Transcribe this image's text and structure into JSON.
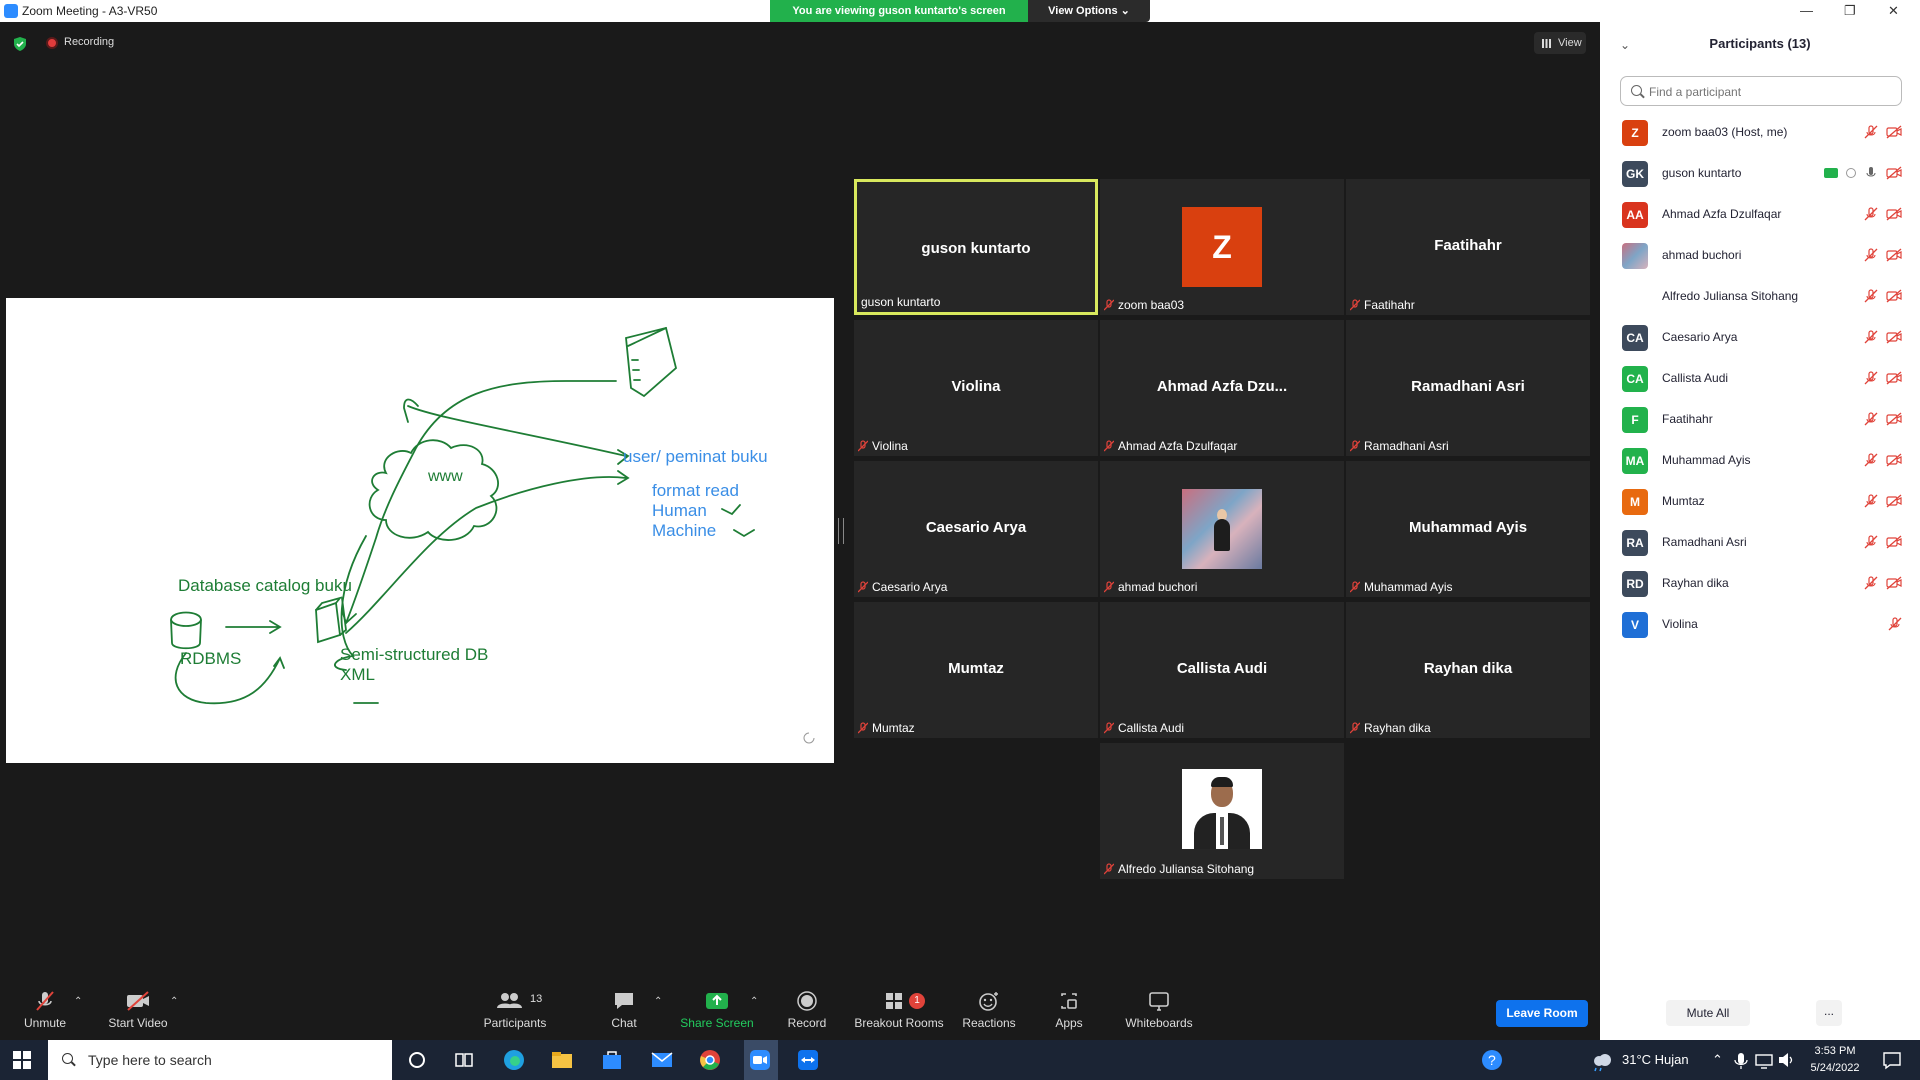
{
  "window": {
    "title": "Zoom Meeting - A3-VR50"
  },
  "banner": {
    "text": "You are viewing guson kuntarto's screen",
    "view_options": "View Options ⌄"
  },
  "topbar": {
    "recording": "Recording",
    "view": "View"
  },
  "whiteboard": {
    "texts": [
      "user/ peminat buku",
      "format read",
      "Human",
      "Machine",
      "www",
      "Database catalog buku",
      "RDBMS",
      "Semi-structured DB",
      "XML"
    ]
  },
  "tiles": [
    {
      "center": "guson kuntarto",
      "tag": "guson kuntarto",
      "active": true,
      "muted": false
    },
    {
      "center": "",
      "tag": "zoom baa03",
      "avatar": "Z"
    },
    {
      "center": "Faatihahr",
      "tag": "Faatihahr"
    },
    {
      "center": "Violina",
      "tag": "Violina"
    },
    {
      "center": "Ahmad  Azfa  Dzu...",
      "tag": "Ahmad Azfa Dzulfaqar"
    },
    {
      "center": "Ramadhani Asri",
      "tag": "Ramadhani Asri"
    },
    {
      "center": "Caesario Arya",
      "tag": "Caesario Arya"
    },
    {
      "center": "",
      "tag": "ahmad buchori"
    },
    {
      "center": "Muhammad Ayis",
      "tag": "Muhammad Ayis"
    },
    {
      "center": "Mumtaz",
      "tag": "Mumtaz"
    },
    {
      "center": "Callista Audi",
      "tag": "Callista Audi"
    },
    {
      "center": "Rayhan dika",
      "tag": "Rayhan dika"
    },
    {
      "center": "",
      "tag": "Alfredo Juliansa Sitohang"
    }
  ],
  "toolbar": {
    "unmute": "Unmute",
    "start_video": "Start Video",
    "participants": "Participants",
    "participants_count": "13",
    "chat": "Chat",
    "share_screen": "Share Screen",
    "record": "Record",
    "breakout_rooms": "Breakout Rooms",
    "breakout_badge": "1",
    "reactions": "Reactions",
    "apps": "Apps",
    "whiteboards": "Whiteboards",
    "leave_room": "Leave Room"
  },
  "panel": {
    "title": "Participants (13)",
    "search_placeholder": "Find a participant",
    "participants": [
      {
        "initials": "Z",
        "name": "zoom baa03 (Host, me)",
        "color": "#d9400f"
      },
      {
        "initials": "GK",
        "name": "guson kuntarto",
        "color": "#3d4a5c"
      },
      {
        "initials": "AA",
        "name": "Ahmad Azfa Dzulfaqar",
        "color": "#d9341e"
      },
      {
        "initials": "",
        "name": "ahmad buchori",
        "color": "#c78f9d"
      },
      {
        "initials": "",
        "name": "Alfredo Juliansa Sitohang",
        "color": "#ffffff"
      },
      {
        "initials": "CA",
        "name": "Caesario Arya",
        "color": "#3d4a5c"
      },
      {
        "initials": "CA",
        "name": "Callista Audi",
        "color": "#22b24c"
      },
      {
        "initials": "F",
        "name": "Faatihahr",
        "color": "#22b24c"
      },
      {
        "initials": "MA",
        "name": "Muhammad Ayis",
        "color": "#22b24c"
      },
      {
        "initials": "M",
        "name": "Mumtaz",
        "color": "#e86a10"
      },
      {
        "initials": "RA",
        "name": "Ramadhani Asri",
        "color": "#3d4a5c"
      },
      {
        "initials": "RD",
        "name": "Rayhan dika",
        "color": "#3d4a5c"
      },
      {
        "initials": "V",
        "name": "Violina",
        "color": "#1f6fd6"
      }
    ],
    "mute_all": "Mute All",
    "more": "..."
  },
  "taskbar": {
    "search_placeholder": "Type here to search",
    "weather": "31°C  Hujan",
    "time": "3:53 PM",
    "date": "5/24/2022"
  },
  "colors": {
    "accent": "#0e72ed",
    "green": "#22b14c",
    "active_border": "#d8e85d",
    "ink_green": "#1e7d35",
    "ink_blue": "#3a8ee6"
  }
}
